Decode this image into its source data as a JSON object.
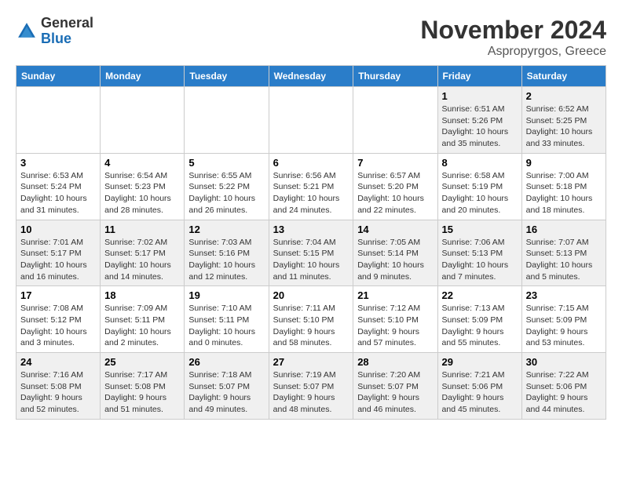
{
  "header": {
    "logo_line1": "General",
    "logo_line2": "Blue",
    "month_title": "November 2024",
    "location": "Aspropyrgos, Greece"
  },
  "days_of_week": [
    "Sunday",
    "Monday",
    "Tuesday",
    "Wednesday",
    "Thursday",
    "Friday",
    "Saturday"
  ],
  "weeks": [
    [
      {
        "day": "",
        "content": ""
      },
      {
        "day": "",
        "content": ""
      },
      {
        "day": "",
        "content": ""
      },
      {
        "day": "",
        "content": ""
      },
      {
        "day": "",
        "content": ""
      },
      {
        "day": "1",
        "content": "Sunrise: 6:51 AM\nSunset: 5:26 PM\nDaylight: 10 hours and 35 minutes."
      },
      {
        "day": "2",
        "content": "Sunrise: 6:52 AM\nSunset: 5:25 PM\nDaylight: 10 hours and 33 minutes."
      }
    ],
    [
      {
        "day": "3",
        "content": "Sunrise: 6:53 AM\nSunset: 5:24 PM\nDaylight: 10 hours and 31 minutes."
      },
      {
        "day": "4",
        "content": "Sunrise: 6:54 AM\nSunset: 5:23 PM\nDaylight: 10 hours and 28 minutes."
      },
      {
        "day": "5",
        "content": "Sunrise: 6:55 AM\nSunset: 5:22 PM\nDaylight: 10 hours and 26 minutes."
      },
      {
        "day": "6",
        "content": "Sunrise: 6:56 AM\nSunset: 5:21 PM\nDaylight: 10 hours and 24 minutes."
      },
      {
        "day": "7",
        "content": "Sunrise: 6:57 AM\nSunset: 5:20 PM\nDaylight: 10 hours and 22 minutes."
      },
      {
        "day": "8",
        "content": "Sunrise: 6:58 AM\nSunset: 5:19 PM\nDaylight: 10 hours and 20 minutes."
      },
      {
        "day": "9",
        "content": "Sunrise: 7:00 AM\nSunset: 5:18 PM\nDaylight: 10 hours and 18 minutes."
      }
    ],
    [
      {
        "day": "10",
        "content": "Sunrise: 7:01 AM\nSunset: 5:17 PM\nDaylight: 10 hours and 16 minutes."
      },
      {
        "day": "11",
        "content": "Sunrise: 7:02 AM\nSunset: 5:17 PM\nDaylight: 10 hours and 14 minutes."
      },
      {
        "day": "12",
        "content": "Sunrise: 7:03 AM\nSunset: 5:16 PM\nDaylight: 10 hours and 12 minutes."
      },
      {
        "day": "13",
        "content": "Sunrise: 7:04 AM\nSunset: 5:15 PM\nDaylight: 10 hours and 11 minutes."
      },
      {
        "day": "14",
        "content": "Sunrise: 7:05 AM\nSunset: 5:14 PM\nDaylight: 10 hours and 9 minutes."
      },
      {
        "day": "15",
        "content": "Sunrise: 7:06 AM\nSunset: 5:13 PM\nDaylight: 10 hours and 7 minutes."
      },
      {
        "day": "16",
        "content": "Sunrise: 7:07 AM\nSunset: 5:13 PM\nDaylight: 10 hours and 5 minutes."
      }
    ],
    [
      {
        "day": "17",
        "content": "Sunrise: 7:08 AM\nSunset: 5:12 PM\nDaylight: 10 hours and 3 minutes."
      },
      {
        "day": "18",
        "content": "Sunrise: 7:09 AM\nSunset: 5:11 PM\nDaylight: 10 hours and 2 minutes."
      },
      {
        "day": "19",
        "content": "Sunrise: 7:10 AM\nSunset: 5:11 PM\nDaylight: 10 hours and 0 minutes."
      },
      {
        "day": "20",
        "content": "Sunrise: 7:11 AM\nSunset: 5:10 PM\nDaylight: 9 hours and 58 minutes."
      },
      {
        "day": "21",
        "content": "Sunrise: 7:12 AM\nSunset: 5:10 PM\nDaylight: 9 hours and 57 minutes."
      },
      {
        "day": "22",
        "content": "Sunrise: 7:13 AM\nSunset: 5:09 PM\nDaylight: 9 hours and 55 minutes."
      },
      {
        "day": "23",
        "content": "Sunrise: 7:15 AM\nSunset: 5:09 PM\nDaylight: 9 hours and 53 minutes."
      }
    ],
    [
      {
        "day": "24",
        "content": "Sunrise: 7:16 AM\nSunset: 5:08 PM\nDaylight: 9 hours and 52 minutes."
      },
      {
        "day": "25",
        "content": "Sunrise: 7:17 AM\nSunset: 5:08 PM\nDaylight: 9 hours and 51 minutes."
      },
      {
        "day": "26",
        "content": "Sunrise: 7:18 AM\nSunset: 5:07 PM\nDaylight: 9 hours and 49 minutes."
      },
      {
        "day": "27",
        "content": "Sunrise: 7:19 AM\nSunset: 5:07 PM\nDaylight: 9 hours and 48 minutes."
      },
      {
        "day": "28",
        "content": "Sunrise: 7:20 AM\nSunset: 5:07 PM\nDaylight: 9 hours and 46 minutes."
      },
      {
        "day": "29",
        "content": "Sunrise: 7:21 AM\nSunset: 5:06 PM\nDaylight: 9 hours and 45 minutes."
      },
      {
        "day": "30",
        "content": "Sunrise: 7:22 AM\nSunset: 5:06 PM\nDaylight: 9 hours and 44 minutes."
      }
    ]
  ]
}
